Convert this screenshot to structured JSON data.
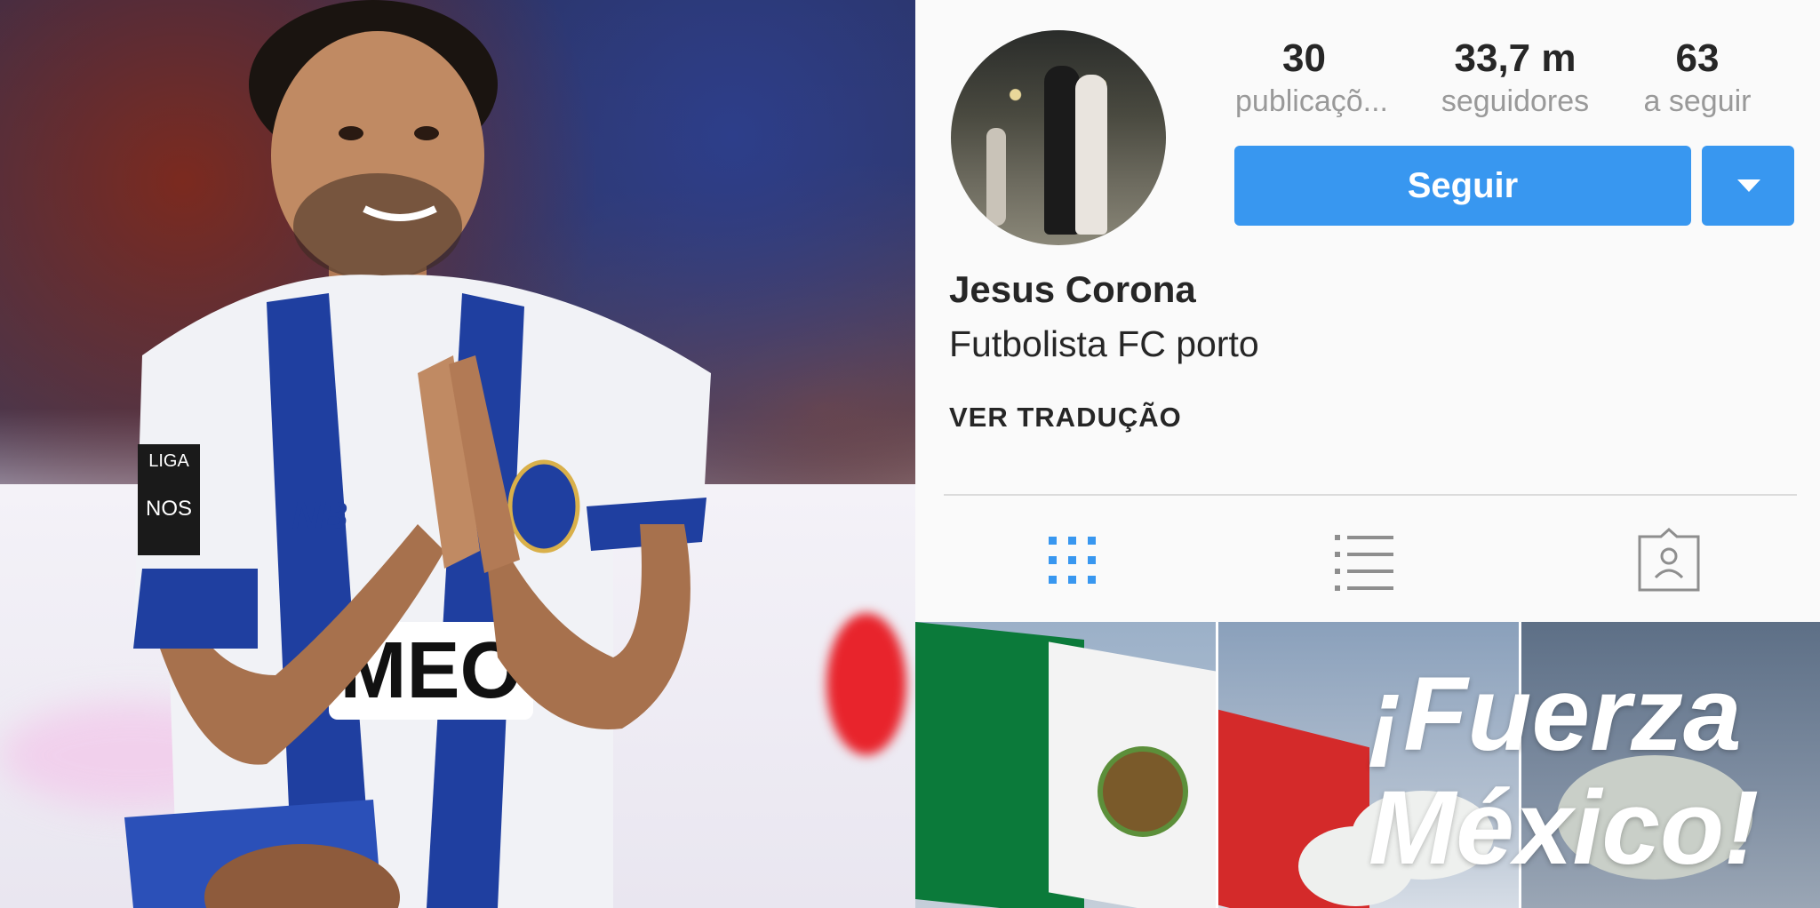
{
  "profile": {
    "stats": [
      {
        "value": "30",
        "label": "publicaçõ..."
      },
      {
        "value": "33,7 m",
        "label": "seguidores"
      },
      {
        "value": "63",
        "label": "a seguir"
      }
    ],
    "follow_label": "Seguir",
    "name": "Jesus Corona",
    "bio": "Futbolista FC porto",
    "translate_label": "VER TRADUÇÃO"
  },
  "tabs": [
    {
      "icon": "grid-icon",
      "active": true
    },
    {
      "icon": "list-icon",
      "active": false
    },
    {
      "icon": "tagged-photos-icon",
      "active": false
    }
  ],
  "posts": {
    "overlay_text_line1": "¡Fuerza",
    "overlay_text_line2": "México!"
  },
  "photo": {
    "jersey_sponsor": "MEO",
    "jersey_badge": "LIGA NOS"
  },
  "colors": {
    "accent": "#3897f0",
    "text": "#262626",
    "muted": "#999999",
    "divider": "#dbdbdb"
  }
}
